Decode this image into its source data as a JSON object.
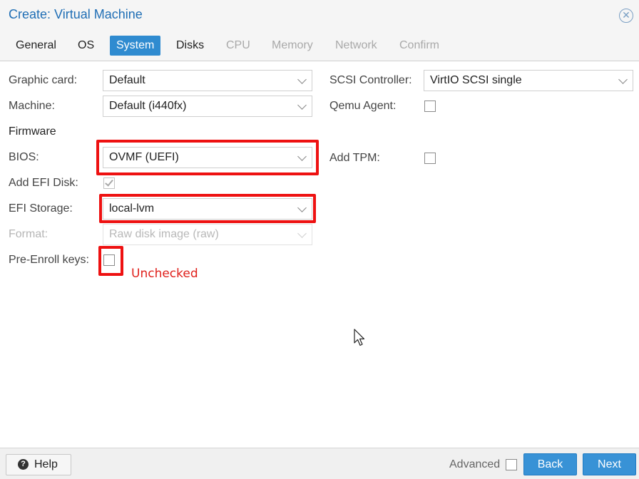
{
  "window": {
    "title": "Create: Virtual Machine"
  },
  "tabs": [
    {
      "label": "General",
      "state": "normal"
    },
    {
      "label": "OS",
      "state": "normal"
    },
    {
      "label": "System",
      "state": "active"
    },
    {
      "label": "Disks",
      "state": "normal"
    },
    {
      "label": "CPU",
      "state": "disabled"
    },
    {
      "label": "Memory",
      "state": "disabled"
    },
    {
      "label": "Network",
      "state": "disabled"
    },
    {
      "label": "Confirm",
      "state": "disabled"
    }
  ],
  "form": {
    "graphic_card": {
      "label": "Graphic card:",
      "value": "Default"
    },
    "machine": {
      "label": "Machine:",
      "value": "Default (i440fx)"
    },
    "firmware_heading": "Firmware",
    "bios": {
      "label": "BIOS:",
      "value": "OVMF (UEFI)"
    },
    "add_efi_disk": {
      "label": "Add EFI Disk:",
      "checked": true,
      "disabled": true
    },
    "efi_storage": {
      "label": "EFI Storage:",
      "value": "local-lvm"
    },
    "format": {
      "label": "Format:",
      "value": "Raw disk image (raw)",
      "disabled": true
    },
    "pre_enroll_keys": {
      "label": "Pre-Enroll keys:",
      "checked": false
    },
    "scsi_controller": {
      "label": "SCSI Controller:",
      "value": "VirtIO SCSI single"
    },
    "qemu_agent": {
      "label": "Qemu Agent:",
      "checked": false
    },
    "add_tpm": {
      "label": "Add TPM:",
      "checked": false
    }
  },
  "annotation": {
    "text": "Unchecked",
    "color": "#e0201b"
  },
  "footer": {
    "help_label": "Help",
    "advanced_label": "Advanced",
    "advanced_checked": false,
    "back_label": "Back",
    "next_label": "Next"
  },
  "colors": {
    "accent": "#2f8bd0",
    "title": "#1f6eb5",
    "highlight": "#ee1111"
  }
}
